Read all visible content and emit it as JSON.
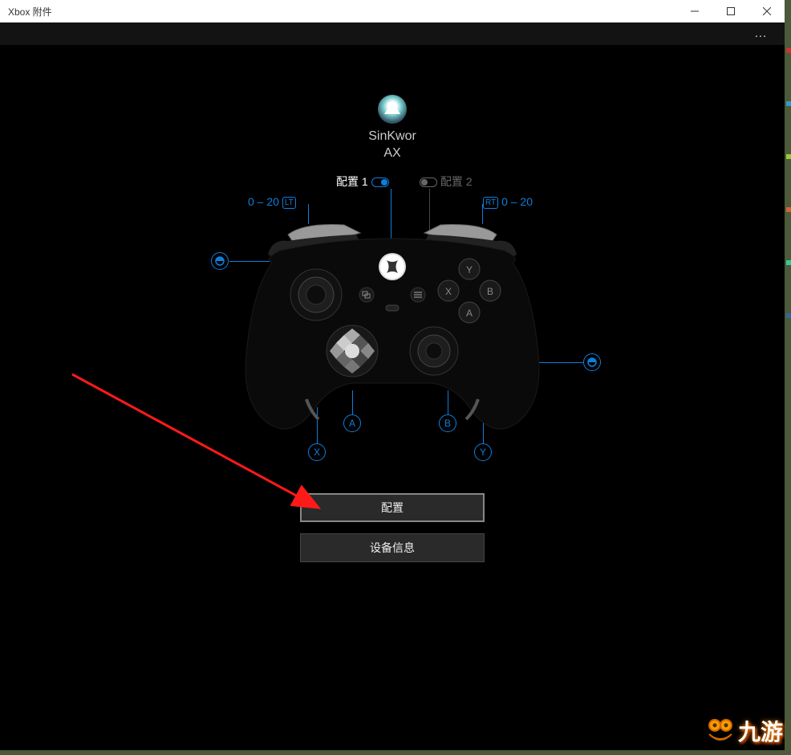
{
  "window": {
    "title": "Xbox 附件"
  },
  "user": {
    "name_line1": "SinKwor",
    "name_line2": "AX"
  },
  "configs": {
    "config1_label": "配置 1",
    "config2_label": "配置 2"
  },
  "triggers": {
    "lt_range": "0 – 20",
    "lt_tag": "LT",
    "rt_range": "0 – 20",
    "rt_tag": "RT"
  },
  "buttons": {
    "a": "A",
    "b": "B",
    "x": "X",
    "y": "Y"
  },
  "actions": {
    "configure": "配置",
    "device_info": "设备信息"
  },
  "watermark": {
    "text": "九游"
  },
  "colors": {
    "accent": "#0e7edb",
    "inactive": "#666666"
  }
}
